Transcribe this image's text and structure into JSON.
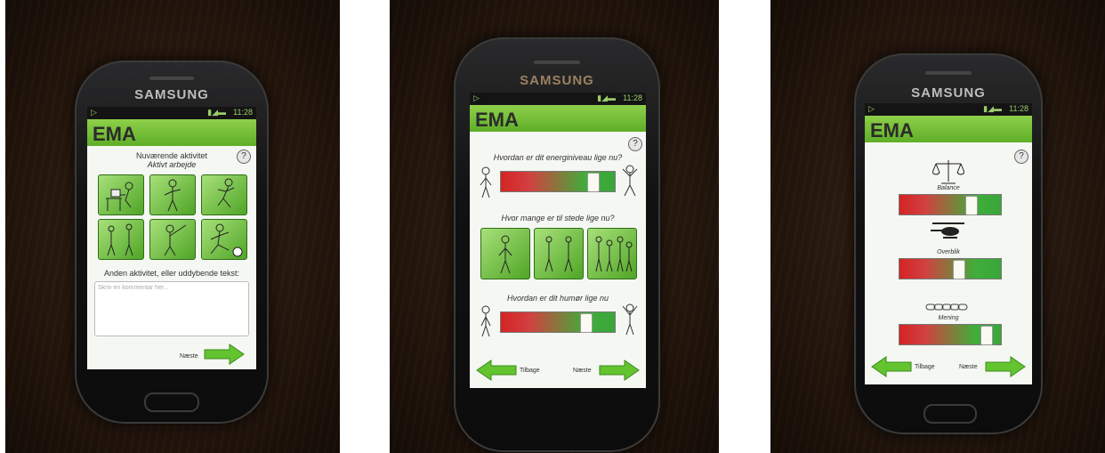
{
  "brand": "SAMSUNG",
  "status": {
    "time": "11:28"
  },
  "app": {
    "title": "EMA",
    "help": "?"
  },
  "screen1": {
    "heading": "Nuværende aktivitet",
    "subheading": "Aktivt arbejde",
    "tiles": [
      "desk-work",
      "standing-activity",
      "jumping",
      "standing-group",
      "chopping",
      "football"
    ],
    "comment_label": "Anden aktivitet, eller uddybende tekst:",
    "comment_placeholder": "Skriv en kommentar her...",
    "next": "Næste"
  },
  "screen2": {
    "q1": "Hvordan er dit energiniveau lige nu?",
    "q1_value": 0.85,
    "q2": "Hvor mange er til stede lige nu?",
    "tiles": [
      "alone",
      "few-people",
      "many-people"
    ],
    "q3": "Hvordan er dit humør lige nu",
    "q3_value": 0.78,
    "back": "Tilbage",
    "next": "Næste"
  },
  "screen3": {
    "s1_label": "Balance",
    "s1_value": 0.74,
    "s2_label": "Overblik",
    "s2_value": 0.6,
    "s3_label": "Mening",
    "s3_value": 0.91,
    "back": "Tilbage",
    "next": "Næste"
  }
}
